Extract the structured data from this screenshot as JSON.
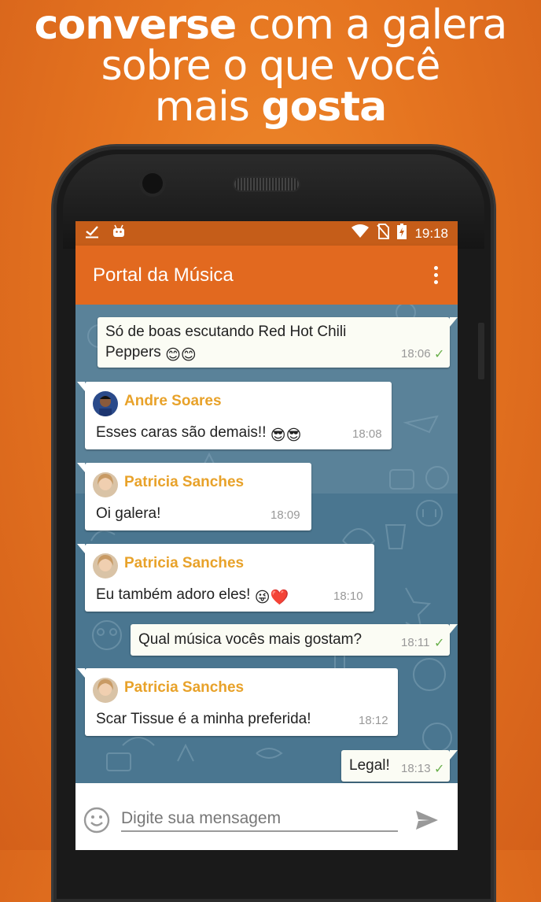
{
  "headline": {
    "line1_bold": "converse",
    "line1_rest": " com a galera",
    "line2": "sobre o que você",
    "line3_rest": "mais ",
    "line3_bold": "gosta"
  },
  "statusbar": {
    "time": "19:18",
    "icons": [
      "download-done-icon",
      "android-icon",
      "wifi-icon",
      "no-sim-icon",
      "battery-charging-icon"
    ]
  },
  "appbar": {
    "title": "Portal da Música",
    "menu_icon": "more-vert-icon"
  },
  "messages": [
    {
      "dir": "out",
      "text1": "Só de boas escutando Red Hot Chili",
      "text2": "Peppers",
      "emoji": "😊😊",
      "time": "18:06",
      "read": true
    },
    {
      "dir": "in",
      "sender": "Andre Soares",
      "text": "Esses caras são demais!!",
      "emoji": "😎😎",
      "time": "18:08"
    },
    {
      "dir": "in",
      "sender": "Patricia Sanches",
      "text": "Oi galera!",
      "time": "18:09"
    },
    {
      "dir": "in",
      "sender": "Patricia Sanches",
      "text": "Eu também adoro eles!",
      "emoji": "😜❤️",
      "time": "18:10"
    },
    {
      "dir": "out",
      "text": "Qual música vocês mais gostam?",
      "time": "18:11",
      "read": true
    },
    {
      "dir": "in",
      "sender": "Patricia Sanches",
      "text": "Scar Tissue é a minha preferida!",
      "time": "18:12"
    },
    {
      "dir": "out",
      "text": "Legal!",
      "time": "18:13",
      "read": true
    }
  ],
  "composer": {
    "placeholder": "Digite sua mensagem",
    "emoji_icon": "smiley-icon",
    "send_icon": "send-icon"
  },
  "colors": {
    "background": "#e57420",
    "statusbar": "#c55d19",
    "appbar": "#e2691f",
    "chat_bg": "#4d7791",
    "sender_name": "#e8a22a",
    "read_check": "#6ab04c"
  }
}
